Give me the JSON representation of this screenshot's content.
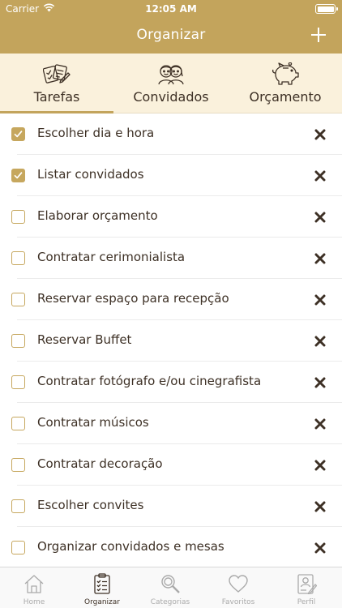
{
  "status_bar": {
    "carrier": "Carrier",
    "time": "12:05 AM"
  },
  "nav": {
    "title": "Organizar"
  },
  "tabs": [
    {
      "label": "Tarefas",
      "icon": "tasks-icon",
      "active": true
    },
    {
      "label": "Convidados",
      "icon": "guests-icon",
      "active": false
    },
    {
      "label": "Orçamento",
      "icon": "piggy-bank-icon",
      "active": false
    }
  ],
  "tasks": [
    {
      "label": "Escolher dia e hora",
      "checked": true
    },
    {
      "label": "Listar convidados",
      "checked": true
    },
    {
      "label": "Elaborar orçamento",
      "checked": false
    },
    {
      "label": "Contratar cerimonialista",
      "checked": false
    },
    {
      "label": "Reservar espaço para recepção",
      "checked": false
    },
    {
      "label": "Reservar Buffet",
      "checked": false
    },
    {
      "label": "Contratar fotógrafo e/ou cinegrafista",
      "checked": false
    },
    {
      "label": "Contratar músicos",
      "checked": false
    },
    {
      "label": "Contratar decoração",
      "checked": false
    },
    {
      "label": "Escolher convites",
      "checked": false
    },
    {
      "label": "Organizar convidados e mesas",
      "checked": false
    }
  ],
  "tab_bar": [
    {
      "label": "Home",
      "icon": "home-icon",
      "active": false
    },
    {
      "label": "Organizar",
      "icon": "clipboard-icon",
      "active": true
    },
    {
      "label": "Categorias",
      "icon": "search-icon",
      "active": false
    },
    {
      "label": "Favoritos",
      "icon": "heart-icon",
      "active": false
    },
    {
      "label": "Perfil",
      "icon": "profile-icon",
      "active": false
    }
  ],
  "colors": {
    "accent": "#c3a45c",
    "tab_background": "#faf1dc",
    "text": "#3d3025",
    "inactive": "#aaaaaa"
  }
}
